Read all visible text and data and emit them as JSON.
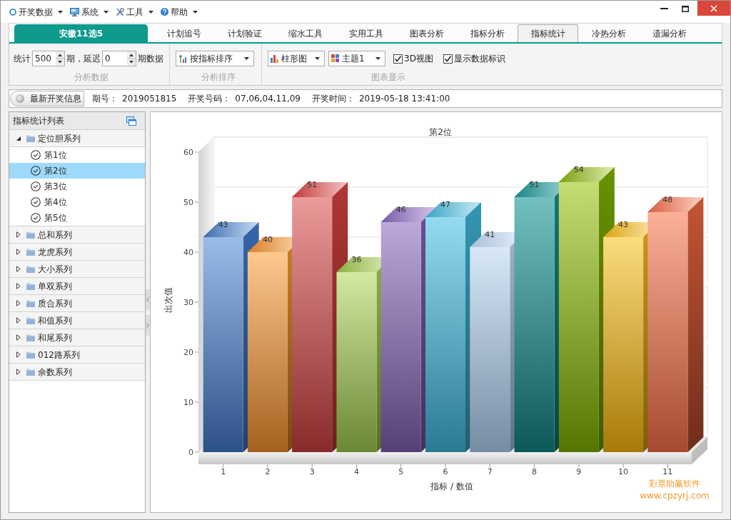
{
  "menu": [
    {
      "label": "开奖数据"
    },
    {
      "label": "系统"
    },
    {
      "label": "工具"
    },
    {
      "label": "帮助"
    }
  ],
  "lottery_tab": {
    "label": "安徽11选5"
  },
  "tabs": [
    {
      "label": "计划追号",
      "selected": false
    },
    {
      "label": "计划验证",
      "selected": false
    },
    {
      "label": "缩水工具",
      "selected": false
    },
    {
      "label": "实用工具",
      "selected": false
    },
    {
      "label": "图表分析",
      "selected": false
    },
    {
      "label": "指标分析",
      "selected": false
    },
    {
      "label": "指标统计",
      "selected": true
    },
    {
      "label": "冷热分析",
      "selected": false
    },
    {
      "label": "遗漏分析",
      "selected": false
    }
  ],
  "toolbar": {
    "analysis_data": {
      "label_1": "统计",
      "count": "500",
      "label_2": "期，延迟",
      "delay": "0",
      "label_3": "期数据",
      "group_label": "分析数据"
    },
    "sort": {
      "value": "按指标排序",
      "group_label": "分析排序"
    },
    "chart_display": {
      "chart_type": "柱形图",
      "theme": "主题1",
      "options": [
        {
          "label": "3D视图",
          "checked": true
        },
        {
          "label": "显示数据标识",
          "checked": true
        }
      ],
      "group_label": "图表显示"
    }
  },
  "draw_info": {
    "button": "最新开奖信息",
    "fields": [
      {
        "label": "期号：",
        "value": "2019051815"
      },
      {
        "label": "开奖号码：",
        "value": "07,06,04,11,09"
      },
      {
        "label": "开奖时间：",
        "value": "2019-05-18 13:41:00"
      }
    ]
  },
  "sidebar": {
    "title": "指标统计列表",
    "items": [
      {
        "label": "定位胆系列",
        "expanded": true,
        "children": [
          {
            "label": "第1位",
            "selected": false
          },
          {
            "label": "第2位",
            "selected": true
          },
          {
            "label": "第3位",
            "selected": false
          },
          {
            "label": "第4位",
            "selected": false
          },
          {
            "label": "第5位",
            "selected": false
          }
        ]
      },
      {
        "label": "总和系列",
        "expanded": false
      },
      {
        "label": "龙虎系列",
        "expanded": false
      },
      {
        "label": "大小系列",
        "expanded": false
      },
      {
        "label": "单双系列",
        "expanded": false
      },
      {
        "label": "质合系列",
        "expanded": false
      },
      {
        "label": "和值系列",
        "expanded": false
      },
      {
        "label": "和尾系列",
        "expanded": false
      },
      {
        "label": "012路系列",
        "expanded": false
      },
      {
        "label": "余数系列",
        "expanded": false
      }
    ]
  },
  "chart": {
    "chart_data": {
      "type": "bar",
      "title": "第2位",
      "xlabel": "指标 / 数值",
      "ylabel": "出次值",
      "categories": [
        "1",
        "2",
        "3",
        "4",
        "5",
        "6",
        "7",
        "8",
        "9",
        "10",
        "11"
      ],
      "values": [
        43,
        40,
        51,
        36,
        46,
        47,
        41,
        51,
        54,
        43,
        48
      ],
      "ylim": [
        0,
        60
      ],
      "yticks": [
        0,
        10,
        20,
        30,
        40,
        50,
        60
      ],
      "data_labels": true
    },
    "credit": [
      "彩票助赢软件",
      "www.cpzyrj.com"
    ]
  }
}
